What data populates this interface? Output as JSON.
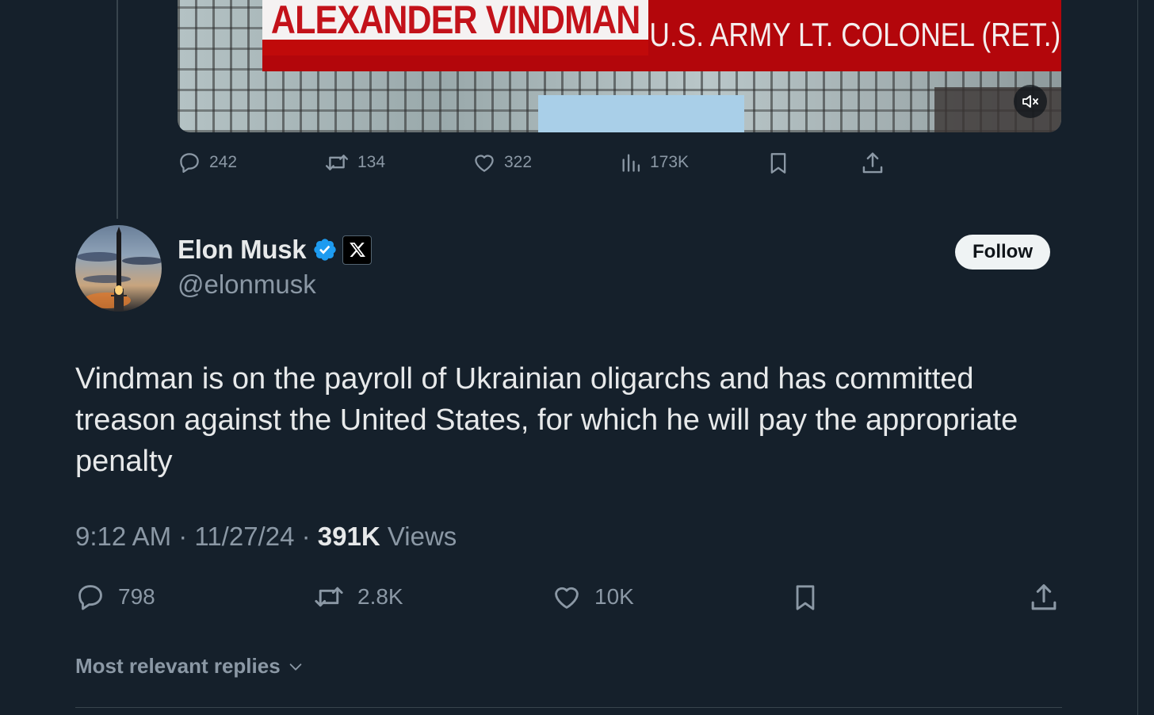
{
  "video": {
    "chyron_name": "ALEXANDER VINDMAN",
    "chyron_title": "U.S. ARMY LT. COLONEL (RET.)",
    "muted": true
  },
  "prev_tweet_actions": {
    "replies": "242",
    "reposts": "134",
    "likes": "322",
    "views": "173K"
  },
  "author": {
    "name": "Elon Musk",
    "handle": "@elonmusk",
    "verified_color": "#1d9bf0",
    "follow_label": "Follow"
  },
  "tweet": {
    "text": "Vindman is on the payroll of Ukrainian oligarchs and has committed treason against the United States, for which he will pay the appropriate penalty",
    "time": "9:12 AM",
    "date": "11/27/24",
    "views_count": "391K",
    "views_label": "Views",
    "separator": "·"
  },
  "tweet_actions": {
    "replies": "798",
    "reposts": "2.8K",
    "likes": "10K"
  },
  "replies_sort": {
    "label": "Most relevant replies"
  },
  "colors": {
    "background": "#15202b",
    "text_primary": "#e7e9ea",
    "text_secondary": "#8b98a5",
    "chyron_red": "#b3060b"
  }
}
